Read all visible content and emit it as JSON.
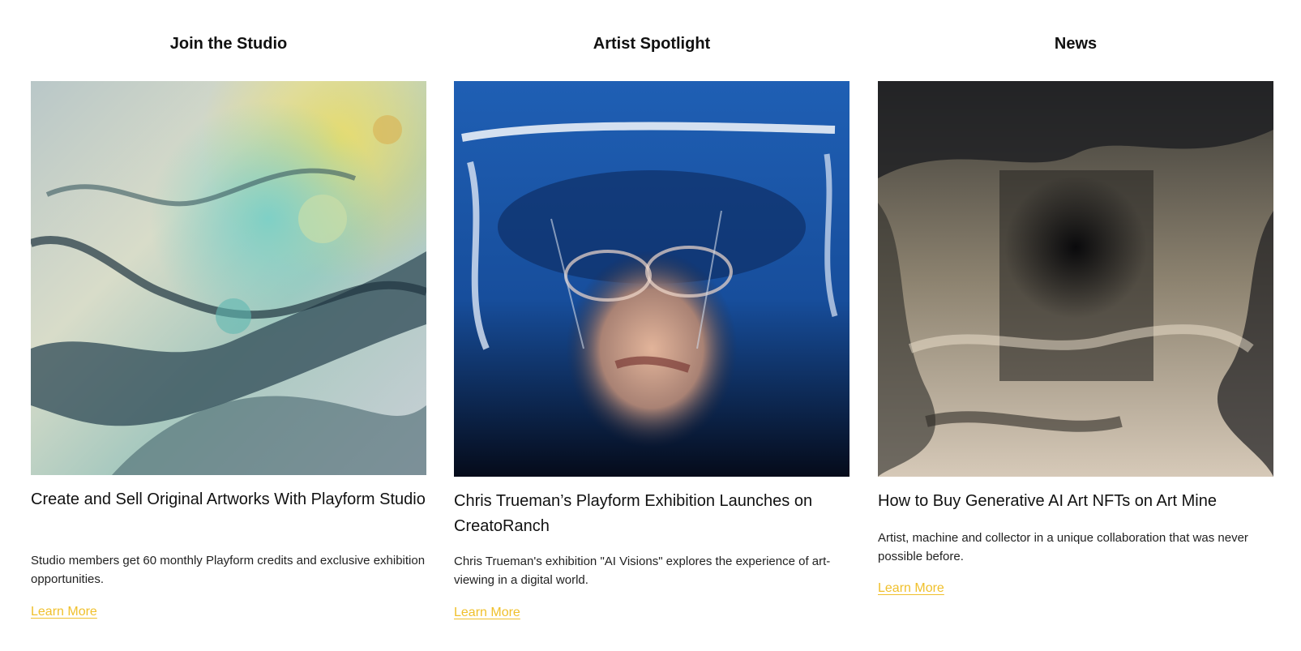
{
  "columns": [
    {
      "heading": "Join the Studio",
      "image_name": "abstract-marbled-artwork",
      "title": "Create and Sell Original Artworks With Playform Studio",
      "description": "Studio members get 60 monthly Playform credits and exclusive exhibition opportunities.",
      "link_label": "Learn More"
    },
    {
      "heading": "Artist Spotlight",
      "image_name": "distorted-portrait-artwork",
      "title": "Chris Trueman’s Playform Exhibition Launches on CreatoRanch",
      "description": "Chris Trueman's exhibition \"AI Visions\" explores the experience of art-viewing in a digital world.",
      "link_label": "Learn More"
    },
    {
      "heading": "News",
      "image_name": "generative-tunnel-artwork",
      "title": "How to Buy Generative AI Art NFTs on Art Mine",
      "description": "Artist, machine and collector in a unique collaboration that was never possible before.",
      "link_label": "Learn More"
    }
  ],
  "colors": {
    "link": "#f0c02c",
    "text": "#111111",
    "background": "#ffffff"
  }
}
